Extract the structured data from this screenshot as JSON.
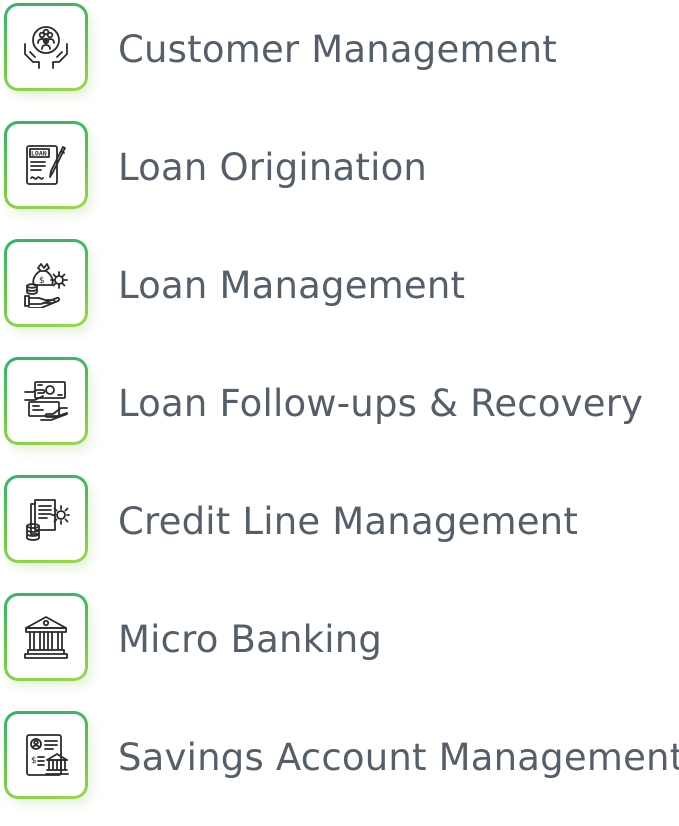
{
  "items": [
    {
      "label": "Customer Management",
      "icon": "customers-in-hands-icon"
    },
    {
      "label": "Loan Origination",
      "icon": "loan-document-pen-icon"
    },
    {
      "label": "Loan Management",
      "icon": "money-bag-gear-hand-icon"
    },
    {
      "label": "Loan Follow-ups & Recovery",
      "icon": "cash-transfer-hands-icon"
    },
    {
      "label": "Credit Line Management",
      "icon": "documents-coins-gear-icon"
    },
    {
      "label": "Micro Banking",
      "icon": "bank-building-icon"
    },
    {
      "label": "Savings Account Management",
      "icon": "savings-account-bank-icon"
    }
  ],
  "colors": {
    "text": "#555f6a",
    "border_start": "#2fb36a",
    "border_end": "#9bd84a",
    "icon_stroke": "#2b2b2b"
  }
}
